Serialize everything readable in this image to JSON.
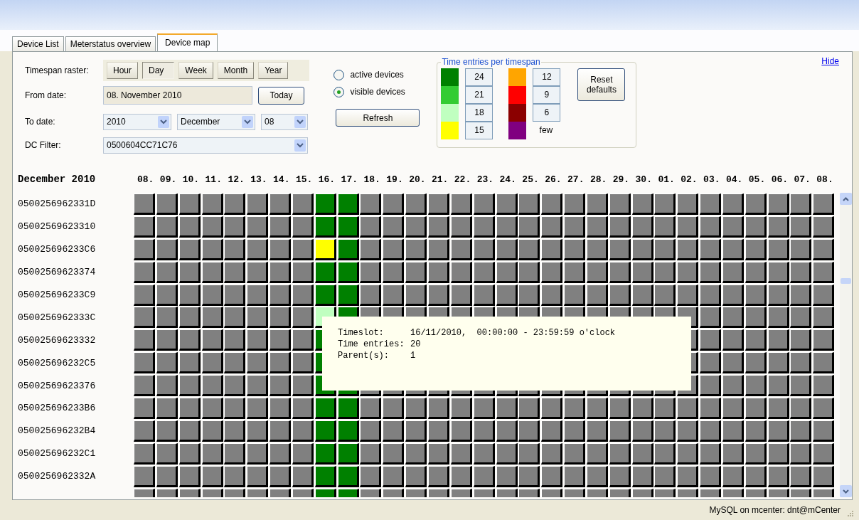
{
  "tabs": [
    {
      "label": "Device List",
      "selected": false
    },
    {
      "label": "Meterstatus overview",
      "selected": false
    },
    {
      "label": "Device map",
      "selected": true
    }
  ],
  "controls": {
    "raster_label": "Timespan raster:",
    "raster_buttons": [
      {
        "label": "Hour",
        "selected": false
      },
      {
        "label": "Day",
        "selected": true
      },
      {
        "label": "Week",
        "selected": false
      },
      {
        "label": "Month",
        "selected": false
      },
      {
        "label": "Year",
        "selected": false
      }
    ],
    "from_label": "From date:",
    "from_value": "08. November 2010",
    "today_button": "Today",
    "to_label": "To date:",
    "to_year": "2010",
    "to_month": "December",
    "to_day": "08",
    "filter_label": "DC Filter:",
    "filter_value": "0500604CC71C76",
    "radios": [
      {
        "label": "active devices",
        "selected": false
      },
      {
        "label": "visible devices",
        "selected": true
      }
    ],
    "refresh_button": "Refresh"
  },
  "legend": {
    "title": "Time entries per timespan",
    "columns": [
      [
        {
          "color": "#008000",
          "kind": "field",
          "value": "24"
        },
        {
          "color": "#33cc33",
          "kind": "field",
          "value": "21"
        },
        {
          "color": "#c0ffc0",
          "kind": "field",
          "value": "18"
        },
        {
          "color": "#ffff00",
          "kind": "field",
          "value": "15"
        }
      ],
      [
        {
          "color": "#ffa500",
          "kind": "field",
          "value": "12"
        },
        {
          "color": "#ff0000",
          "kind": "field",
          "value": "9"
        },
        {
          "color": "#8b0000",
          "kind": "field",
          "value": "6"
        },
        {
          "color": "#800080",
          "kind": "text",
          "value": "few"
        }
      ]
    ],
    "reset_button": "Reset defaults"
  },
  "hide_link": "Hide",
  "map": {
    "month": "December 2010",
    "days": [
      "08.",
      "09.",
      "10.",
      "11.",
      "12.",
      "13.",
      "14.",
      "15.",
      "16.",
      "17.",
      "18.",
      "19.",
      "20.",
      "21.",
      "22.",
      "23.",
      "24.",
      "25.",
      "26.",
      "27.",
      "28.",
      "29.",
      "30.",
      "01.",
      "02.",
      "03.",
      "04.",
      "05.",
      "06.",
      "07.",
      "08."
    ],
    "rows": [
      {
        "id": "0500256962331D",
        "cells": [
          {
            "color": "#808080"
          },
          {
            "color": "#808080"
          },
          {
            "color": "#808080"
          },
          {
            "color": "#808080"
          },
          {
            "color": "#808080"
          },
          {
            "color": "#808080"
          },
          {
            "color": "#808080"
          },
          {
            "color": "#808080"
          },
          {
            "color": "#008000"
          },
          {
            "color": "#008000"
          },
          {
            "color": "#808080"
          },
          {
            "color": "#808080"
          },
          {
            "color": "#808080"
          },
          {
            "color": "#808080"
          },
          {
            "color": "#808080"
          },
          {
            "color": "#808080"
          },
          {
            "color": "#808080"
          },
          {
            "color": "#808080"
          },
          {
            "color": "#808080"
          },
          {
            "color": "#808080"
          },
          {
            "color": "#808080"
          },
          {
            "color": "#808080"
          },
          {
            "color": "#808080"
          },
          {
            "color": "#808080"
          },
          {
            "color": "#808080"
          },
          {
            "color": "#808080"
          },
          {
            "color": "#808080"
          },
          {
            "color": "#808080"
          },
          {
            "color": "#808080"
          },
          {
            "color": "#808080"
          },
          {
            "color": "#808080"
          }
        ]
      },
      {
        "id": "05002569623310",
        "cells": [
          {
            "color": "#808080"
          },
          {
            "color": "#808080"
          },
          {
            "color": "#808080"
          },
          {
            "color": "#808080"
          },
          {
            "color": "#808080"
          },
          {
            "color": "#808080"
          },
          {
            "color": "#808080"
          },
          {
            "color": "#808080"
          },
          {
            "color": "#008000"
          },
          {
            "color": "#008000"
          },
          {
            "color": "#808080"
          },
          {
            "color": "#808080"
          },
          {
            "color": "#808080"
          },
          {
            "color": "#808080"
          },
          {
            "color": "#808080"
          },
          {
            "color": "#808080"
          },
          {
            "color": "#808080"
          },
          {
            "color": "#808080"
          },
          {
            "color": "#808080"
          },
          {
            "color": "#808080"
          },
          {
            "color": "#808080"
          },
          {
            "color": "#808080"
          },
          {
            "color": "#808080"
          },
          {
            "color": "#808080"
          },
          {
            "color": "#808080"
          },
          {
            "color": "#808080"
          },
          {
            "color": "#808080"
          },
          {
            "color": "#808080"
          },
          {
            "color": "#808080"
          },
          {
            "color": "#808080"
          },
          {
            "color": "#808080"
          }
        ]
      },
      {
        "id": "050025696233C6",
        "cells": [
          {
            "color": "#808080"
          },
          {
            "color": "#808080"
          },
          {
            "color": "#808080"
          },
          {
            "color": "#808080"
          },
          {
            "color": "#808080"
          },
          {
            "color": "#808080"
          },
          {
            "color": "#808080"
          },
          {
            "color": "#808080"
          },
          {
            "color": "#ffff00"
          },
          {
            "color": "#008000"
          },
          {
            "color": "#808080"
          },
          {
            "color": "#808080"
          },
          {
            "color": "#808080"
          },
          {
            "color": "#808080"
          },
          {
            "color": "#808080"
          },
          {
            "color": "#808080"
          },
          {
            "color": "#808080"
          },
          {
            "color": "#808080"
          },
          {
            "color": "#808080"
          },
          {
            "color": "#808080"
          },
          {
            "color": "#808080"
          },
          {
            "color": "#808080"
          },
          {
            "color": "#808080"
          },
          {
            "color": "#808080"
          },
          {
            "color": "#808080"
          },
          {
            "color": "#808080"
          },
          {
            "color": "#808080"
          },
          {
            "color": "#808080"
          },
          {
            "color": "#808080"
          },
          {
            "color": "#808080"
          },
          {
            "color": "#808080"
          }
        ]
      },
      {
        "id": "05002569623374",
        "cells": [
          {
            "color": "#808080"
          },
          {
            "color": "#808080"
          },
          {
            "color": "#808080"
          },
          {
            "color": "#808080"
          },
          {
            "color": "#808080"
          },
          {
            "color": "#808080"
          },
          {
            "color": "#808080"
          },
          {
            "color": "#808080"
          },
          {
            "color": "#008000"
          },
          {
            "color": "#008000"
          },
          {
            "color": "#808080"
          },
          {
            "color": "#808080"
          },
          {
            "color": "#808080"
          },
          {
            "color": "#808080"
          },
          {
            "color": "#808080"
          },
          {
            "color": "#808080"
          },
          {
            "color": "#808080"
          },
          {
            "color": "#808080"
          },
          {
            "color": "#808080"
          },
          {
            "color": "#808080"
          },
          {
            "color": "#808080"
          },
          {
            "color": "#808080"
          },
          {
            "color": "#808080"
          },
          {
            "color": "#808080"
          },
          {
            "color": "#808080"
          },
          {
            "color": "#808080"
          },
          {
            "color": "#808080"
          },
          {
            "color": "#808080"
          },
          {
            "color": "#808080"
          },
          {
            "color": "#808080"
          },
          {
            "color": "#808080"
          }
        ]
      },
      {
        "id": "050025696233C9",
        "cells": [
          {
            "color": "#808080"
          },
          {
            "color": "#808080"
          },
          {
            "color": "#808080"
          },
          {
            "color": "#808080"
          },
          {
            "color": "#808080"
          },
          {
            "color": "#808080"
          },
          {
            "color": "#808080"
          },
          {
            "color": "#808080"
          },
          {
            "color": "#008000"
          },
          {
            "color": "#008000"
          },
          {
            "color": "#808080"
          },
          {
            "color": "#808080"
          },
          {
            "color": "#808080"
          },
          {
            "color": "#808080"
          },
          {
            "color": "#808080"
          },
          {
            "color": "#808080"
          },
          {
            "color": "#808080"
          },
          {
            "color": "#808080"
          },
          {
            "color": "#808080"
          },
          {
            "color": "#808080"
          },
          {
            "color": "#808080"
          },
          {
            "color": "#808080"
          },
          {
            "color": "#808080"
          },
          {
            "color": "#808080"
          },
          {
            "color": "#808080"
          },
          {
            "color": "#808080"
          },
          {
            "color": "#808080"
          },
          {
            "color": "#808080"
          },
          {
            "color": "#808080"
          },
          {
            "color": "#808080"
          },
          {
            "color": "#808080"
          }
        ]
      },
      {
        "id": "0500256962333C",
        "cells": [
          {
            "color": "#808080"
          },
          {
            "color": "#808080"
          },
          {
            "color": "#808080"
          },
          {
            "color": "#808080"
          },
          {
            "color": "#808080"
          },
          {
            "color": "#808080"
          },
          {
            "color": "#808080"
          },
          {
            "color": "#808080"
          },
          {
            "color": "#c0ffc0"
          },
          {
            "color": "#008000"
          },
          {
            "color": "#808080"
          },
          {
            "color": "#808080"
          },
          {
            "color": "#808080"
          },
          {
            "color": "#808080"
          },
          {
            "color": "#808080"
          },
          {
            "color": "#808080"
          },
          {
            "color": "#808080"
          },
          {
            "color": "#808080"
          },
          {
            "color": "#808080"
          },
          {
            "color": "#808080"
          },
          {
            "color": "#808080"
          },
          {
            "color": "#808080"
          },
          {
            "color": "#808080"
          },
          {
            "color": "#808080"
          },
          {
            "color": "#808080"
          },
          {
            "color": "#808080"
          },
          {
            "color": "#808080"
          },
          {
            "color": "#808080"
          },
          {
            "color": "#808080"
          },
          {
            "color": "#808080"
          },
          {
            "color": "#808080"
          }
        ]
      },
      {
        "id": "05002569623332",
        "cells": [
          {
            "color": "#808080"
          },
          {
            "color": "#808080"
          },
          {
            "color": "#808080"
          },
          {
            "color": "#808080"
          },
          {
            "color": "#808080"
          },
          {
            "color": "#808080"
          },
          {
            "color": "#808080"
          },
          {
            "color": "#808080"
          },
          {
            "color": "#008000"
          },
          null,
          null,
          null,
          null,
          null,
          null,
          null,
          null,
          null,
          null,
          null,
          null,
          null,
          null,
          null,
          {
            "color": "#808080"
          },
          {
            "color": "#808080"
          },
          {
            "color": "#808080"
          },
          {
            "color": "#808080"
          },
          {
            "color": "#808080"
          },
          {
            "color": "#808080"
          },
          {
            "color": "#808080"
          }
        ]
      },
      {
        "id": "050025696232C5",
        "cells": [
          {
            "color": "#808080"
          },
          {
            "color": "#808080"
          },
          {
            "color": "#808080"
          },
          {
            "color": "#808080"
          },
          {
            "color": "#808080"
          },
          {
            "color": "#808080"
          },
          {
            "color": "#808080"
          },
          {
            "color": "#808080"
          },
          {
            "color": "#008000"
          },
          null,
          null,
          null,
          null,
          null,
          null,
          null,
          null,
          null,
          null,
          null,
          null,
          null,
          null,
          null,
          {
            "color": "#808080"
          },
          {
            "color": "#808080"
          },
          {
            "color": "#808080"
          },
          {
            "color": "#808080"
          },
          {
            "color": "#808080"
          },
          {
            "color": "#808080"
          },
          {
            "color": "#808080"
          }
        ]
      },
      {
        "id": "05002569623376",
        "cells": [
          {
            "color": "#808080"
          },
          {
            "color": "#808080"
          },
          {
            "color": "#808080"
          },
          {
            "color": "#808080"
          },
          {
            "color": "#808080"
          },
          {
            "color": "#808080"
          },
          {
            "color": "#808080"
          },
          {
            "color": "#808080"
          },
          {
            "color": "#008000"
          },
          {
            "color": "#008000"
          },
          {
            "color": "#808080"
          },
          {
            "color": "#808080"
          },
          {
            "color": "#808080"
          },
          {
            "color": "#808080"
          },
          {
            "color": "#808080"
          },
          {
            "color": "#808080"
          },
          {
            "color": "#808080"
          },
          {
            "color": "#808080"
          },
          {
            "color": "#808080"
          },
          {
            "color": "#808080"
          },
          {
            "color": "#808080"
          },
          {
            "color": "#808080"
          },
          {
            "color": "#808080"
          },
          {
            "color": "#808080"
          },
          {
            "color": "#808080"
          },
          {
            "color": "#808080"
          },
          {
            "color": "#808080"
          },
          {
            "color": "#808080"
          },
          {
            "color": "#808080"
          },
          {
            "color": "#808080"
          },
          {
            "color": "#808080"
          }
        ]
      },
      {
        "id": "050025696233B6",
        "cells": [
          {
            "color": "#808080"
          },
          {
            "color": "#808080"
          },
          {
            "color": "#808080"
          },
          {
            "color": "#808080"
          },
          {
            "color": "#808080"
          },
          {
            "color": "#808080"
          },
          {
            "color": "#808080"
          },
          {
            "color": "#808080"
          },
          {
            "color": "#008000"
          },
          {
            "color": "#008000"
          },
          {
            "color": "#808080"
          },
          {
            "color": "#808080"
          },
          {
            "color": "#808080"
          },
          {
            "color": "#808080"
          },
          {
            "color": "#808080"
          },
          {
            "color": "#808080"
          },
          {
            "color": "#808080"
          },
          {
            "color": "#808080"
          },
          {
            "color": "#808080"
          },
          {
            "color": "#808080"
          },
          {
            "color": "#808080"
          },
          {
            "color": "#808080"
          },
          {
            "color": "#808080"
          },
          {
            "color": "#808080"
          },
          {
            "color": "#808080"
          },
          {
            "color": "#808080"
          },
          {
            "color": "#808080"
          },
          {
            "color": "#808080"
          },
          {
            "color": "#808080"
          },
          {
            "color": "#808080"
          },
          {
            "color": "#808080"
          }
        ]
      },
      {
        "id": "050025696232B4",
        "cells": [
          {
            "color": "#808080"
          },
          {
            "color": "#808080"
          },
          {
            "color": "#808080"
          },
          {
            "color": "#808080"
          },
          {
            "color": "#808080"
          },
          {
            "color": "#808080"
          },
          {
            "color": "#808080"
          },
          {
            "color": "#808080"
          },
          {
            "color": "#008000"
          },
          {
            "color": "#008000"
          },
          {
            "color": "#808080"
          },
          {
            "color": "#808080"
          },
          {
            "color": "#808080"
          },
          {
            "color": "#808080"
          },
          {
            "color": "#808080"
          },
          {
            "color": "#808080"
          },
          {
            "color": "#808080"
          },
          {
            "color": "#808080"
          },
          {
            "color": "#808080"
          },
          {
            "color": "#808080"
          },
          {
            "color": "#808080"
          },
          {
            "color": "#808080"
          },
          {
            "color": "#808080"
          },
          {
            "color": "#808080"
          },
          {
            "color": "#808080"
          },
          {
            "color": "#808080"
          },
          {
            "color": "#808080"
          },
          {
            "color": "#808080"
          },
          {
            "color": "#808080"
          },
          {
            "color": "#808080"
          },
          {
            "color": "#808080"
          }
        ]
      },
      {
        "id": "050025696232C1",
        "cells": [
          {
            "color": "#808080"
          },
          {
            "color": "#808080"
          },
          {
            "color": "#808080"
          },
          {
            "color": "#808080"
          },
          {
            "color": "#808080"
          },
          {
            "color": "#808080"
          },
          {
            "color": "#808080"
          },
          {
            "color": "#808080"
          },
          {
            "color": "#008000"
          },
          {
            "color": "#008000"
          },
          {
            "color": "#808080"
          },
          {
            "color": "#808080"
          },
          {
            "color": "#808080"
          },
          {
            "color": "#808080"
          },
          {
            "color": "#808080"
          },
          {
            "color": "#808080"
          },
          {
            "color": "#808080"
          },
          {
            "color": "#808080"
          },
          {
            "color": "#808080"
          },
          {
            "color": "#808080"
          },
          {
            "color": "#808080"
          },
          {
            "color": "#808080"
          },
          {
            "color": "#808080"
          },
          {
            "color": "#808080"
          },
          {
            "color": "#808080"
          },
          {
            "color": "#808080"
          },
          {
            "color": "#808080"
          },
          {
            "color": "#808080"
          },
          {
            "color": "#808080"
          },
          {
            "color": "#808080"
          },
          {
            "color": "#808080"
          }
        ]
      },
      {
        "id": "0500256962332A",
        "cells": [
          {
            "color": "#808080"
          },
          {
            "color": "#808080"
          },
          {
            "color": "#808080"
          },
          {
            "color": "#808080"
          },
          {
            "color": "#808080"
          },
          {
            "color": "#808080"
          },
          {
            "color": "#808080"
          },
          {
            "color": "#808080"
          },
          {
            "color": "#008000"
          },
          {
            "color": "#008000"
          },
          {
            "color": "#808080"
          },
          {
            "color": "#808080"
          },
          {
            "color": "#808080"
          },
          {
            "color": "#808080"
          },
          {
            "color": "#808080"
          },
          {
            "color": "#808080"
          },
          {
            "color": "#808080"
          },
          {
            "color": "#808080"
          },
          {
            "color": "#808080"
          },
          {
            "color": "#808080"
          },
          {
            "color": "#808080"
          },
          {
            "color": "#808080"
          },
          {
            "color": "#808080"
          },
          {
            "color": "#808080"
          },
          {
            "color": "#808080"
          },
          {
            "color": "#808080"
          },
          {
            "color": "#808080"
          },
          {
            "color": "#808080"
          },
          {
            "color": "#808080"
          },
          {
            "color": "#808080"
          },
          {
            "color": "#808080"
          }
        ]
      },
      {
        "cells": [
          {
            "color": "#808080"
          },
          {
            "color": "#808080"
          },
          {
            "color": "#808080"
          },
          {
            "color": "#808080"
          },
          {
            "color": "#808080"
          },
          {
            "color": "#808080"
          },
          {
            "color": "#808080"
          },
          {
            "color": "#808080"
          },
          {
            "color": "#008000"
          },
          {
            "color": "#008000"
          },
          {
            "color": "#808080"
          },
          {
            "color": "#808080"
          },
          {
            "color": "#808080"
          },
          {
            "color": "#808080"
          },
          {
            "color": "#808080"
          },
          {
            "color": "#808080"
          },
          {
            "color": "#808080"
          },
          {
            "color": "#808080"
          },
          {
            "color": "#808080"
          },
          {
            "color": "#808080"
          },
          {
            "color": "#808080"
          },
          {
            "color": "#808080"
          },
          {
            "color": "#808080"
          },
          {
            "color": "#808080"
          },
          {
            "color": "#808080"
          },
          {
            "color": "#808080"
          },
          {
            "color": "#808080"
          },
          {
            "color": "#808080"
          },
          {
            "color": "#808080"
          },
          {
            "color": "#808080"
          },
          {
            "color": "#808080"
          }
        ]
      }
    ],
    "tooltip": [
      {
        "label": "Timeslot:",
        "value": "16/11/2010,  00:00:00 - 23:59:59 o'clock"
      },
      {
        "label": "Time entries:",
        "value": "20"
      },
      {
        "label": "Parent(s):",
        "value": "1"
      }
    ]
  },
  "status_bar": {
    "text": "MySQL on mcenter: dnt@mCenter"
  }
}
